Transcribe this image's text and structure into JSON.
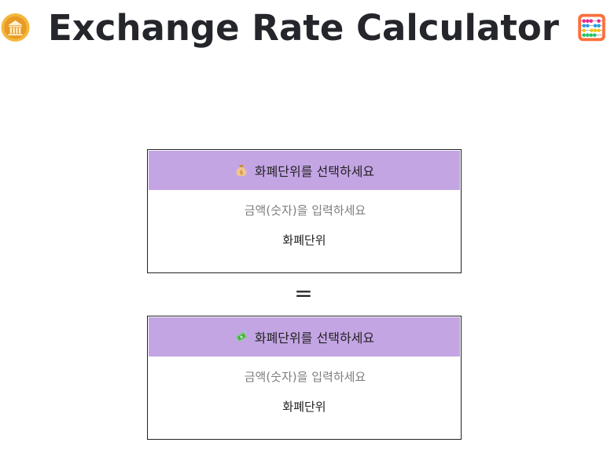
{
  "header": {
    "title": "Exchange Rate Calculator",
    "left_icon": "bank-icon",
    "right_icon": "abacus-icon"
  },
  "from_panel": {
    "select_icon": "money-bag-icon",
    "select_label": "화폐단위를 선택하세요",
    "amount_placeholder": "금액(숫자)을 입력하세요",
    "amount_value": "",
    "unit_label": "화폐단위"
  },
  "equals_sign": "=",
  "to_panel": {
    "select_icon": "flying-money-icon",
    "select_label": "화폐단위를 선택하세요",
    "amount_placeholder": "금액(숫자)을 입력하세요",
    "amount_value": "",
    "unit_label": "화폐단위"
  },
  "colors": {
    "select_bar": "#c4a5e4",
    "title": "#24262b",
    "coin": "#f4b73a"
  }
}
